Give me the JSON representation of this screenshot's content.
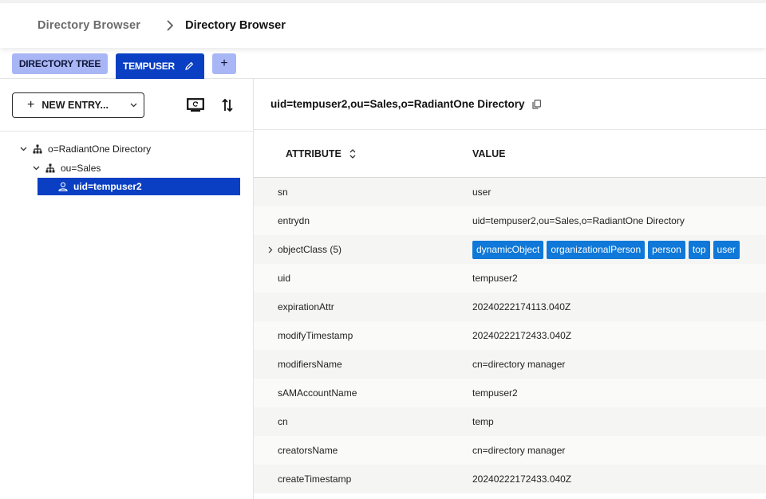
{
  "breadcrumb": {
    "parent": "Directory Browser",
    "current": "Directory Browser"
  },
  "tabs": [
    {
      "label": "DIRECTORY TREE",
      "active": false
    },
    {
      "label": "TEMPUSER",
      "active": true,
      "editable": true
    },
    {
      "label": "+",
      "role": "add-tab"
    }
  ],
  "left_panel": {
    "new_entry_label": "NEW ENTRY...",
    "refresh_icon": "monitor-refresh-icon",
    "sort_icon": "sort-arrows-icon",
    "tree": [
      {
        "label": "o=RadiantOne Directory",
        "icon": "org-tree-icon",
        "expanded": true,
        "level": 1
      },
      {
        "label": "ou=Sales",
        "icon": "org-tree-icon",
        "expanded": true,
        "level": 2
      },
      {
        "label": "uid=tempuser2",
        "icon": "user-icon",
        "selected": true,
        "level": 3
      }
    ]
  },
  "entry": {
    "dn": "uid=tempuser2,ou=Sales,o=RadiantOne Directory",
    "columns": {
      "attribute": "ATTRIBUTE",
      "value": "VALUE"
    },
    "rows": [
      {
        "attribute": "sn",
        "value": "user"
      },
      {
        "attribute": "entrydn",
        "value": "uid=tempuser2,ou=Sales,o=RadiantOne Directory"
      },
      {
        "attribute": "objectClass (5)",
        "expandable": true,
        "chips": [
          "dynamicObject",
          "organizationalPerson",
          "person",
          "top",
          "user"
        ]
      },
      {
        "attribute": "uid",
        "value": "tempuser2"
      },
      {
        "attribute": "expirationAttr",
        "value": "20240222174113.040Z"
      },
      {
        "attribute": "modifyTimestamp",
        "value": "20240222172433.040Z"
      },
      {
        "attribute": "modifiersName",
        "value": "cn=directory manager"
      },
      {
        "attribute": "sAMAccountName",
        "value": "tempuser2"
      },
      {
        "attribute": "cn",
        "value": "temp"
      },
      {
        "attribute": "creatorsName",
        "value": "cn=directory manager"
      },
      {
        "attribute": "createTimestamp",
        "value": "20240222172433.040Z"
      }
    ]
  },
  "colors": {
    "primary": "#0a3fc4",
    "tab_inactive": "#a9b6f5",
    "chip": "#0f78d8"
  }
}
